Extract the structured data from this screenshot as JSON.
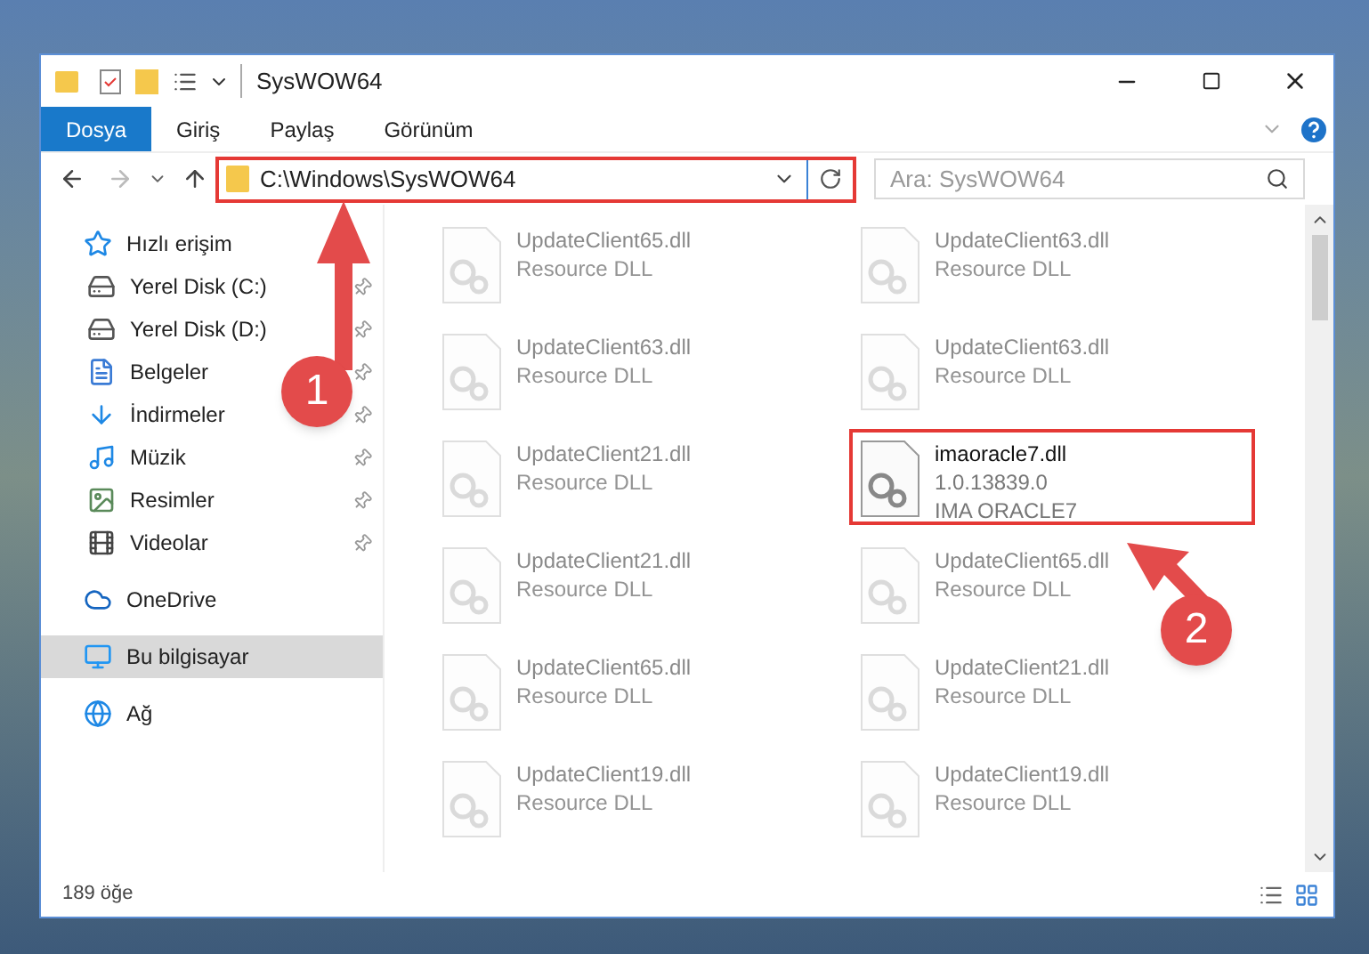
{
  "window": {
    "title": "SysWOW64"
  },
  "ribbon_tabs": [
    {
      "label": "Dosya",
      "kind": "file",
      "selected": false
    },
    {
      "label": "Giriş",
      "kind": "tab",
      "selected": false
    },
    {
      "label": "Paylaş",
      "kind": "tab",
      "selected": false
    },
    {
      "label": "Görünüm",
      "kind": "tab",
      "selected": false
    }
  ],
  "address": {
    "path": "C:\\Windows\\SysWOW64",
    "highlighted": true
  },
  "search": {
    "placeholder": "Ara: SysWOW64"
  },
  "sidebar": {
    "items": [
      {
        "label": "Hızlı erişim",
        "selected": false,
        "children": [
          {
            "label": "Yerel Disk (C:)",
            "pinned": true,
            "selected": false
          },
          {
            "label": "Yerel Disk (D:)",
            "pinned": true,
            "selected": false
          },
          {
            "label": "Belgeler",
            "pinned": true,
            "selected": false
          },
          {
            "label": "İndirmeler",
            "pinned": true,
            "selected": false
          },
          {
            "label": "Müzik",
            "pinned": true,
            "selected": false
          },
          {
            "label": "Resimler",
            "pinned": true,
            "selected": false
          },
          {
            "label": "Videolar",
            "pinned": true,
            "selected": false
          }
        ]
      },
      {
        "label": "OneDrive",
        "selected": false
      },
      {
        "label": "Bu bilgisayar",
        "selected": true
      },
      {
        "label": "Ağ",
        "selected": false
      }
    ]
  },
  "files": [
    {
      "name": "UpdateClient65.dll",
      "details": [
        "Resource DLL"
      ],
      "kind": "faded",
      "highlighted": false
    },
    {
      "name": "UpdateClient63.dll",
      "details": [
        "Resource DLL"
      ],
      "kind": "faded",
      "highlighted": false
    },
    {
      "name": "UpdateClient63.dll",
      "details": [
        "Resource DLL"
      ],
      "kind": "faded",
      "highlighted": false
    },
    {
      "name": "UpdateClient63.dll",
      "details": [
        "Resource DLL"
      ],
      "kind": "faded",
      "highlighted": false
    },
    {
      "name": "UpdateClient21.dll",
      "details": [
        "Resource DLL"
      ],
      "kind": "faded",
      "highlighted": false
    },
    {
      "name": "imaoracle7.dll",
      "details": [
        "1.0.13839.0",
        "IMA ORACLE7"
      ],
      "kind": "clear",
      "highlighted": true
    },
    {
      "name": "UpdateClient21.dll",
      "details": [
        "Resource DLL"
      ],
      "kind": "faded",
      "highlighted": false
    },
    {
      "name": "UpdateClient65.dll",
      "details": [
        "Resource DLL"
      ],
      "kind": "faded",
      "highlighted": false
    },
    {
      "name": "UpdateClient65.dll",
      "details": [
        "Resource DLL"
      ],
      "kind": "faded",
      "highlighted": false
    },
    {
      "name": "UpdateClient21.dll",
      "details": [
        "Resource DLL"
      ],
      "kind": "faded",
      "highlighted": false
    },
    {
      "name": "UpdateClient19.dll",
      "details": [
        "Resource DLL"
      ],
      "kind": "faded",
      "highlighted": false
    },
    {
      "name": "UpdateClient19.dll",
      "details": [
        "Resource DLL"
      ],
      "kind": "faded",
      "highlighted": false
    }
  ],
  "status_bar": {
    "count": "189 öğe"
  },
  "callouts": [
    {
      "label": "1"
    },
    {
      "label": "2"
    }
  ]
}
